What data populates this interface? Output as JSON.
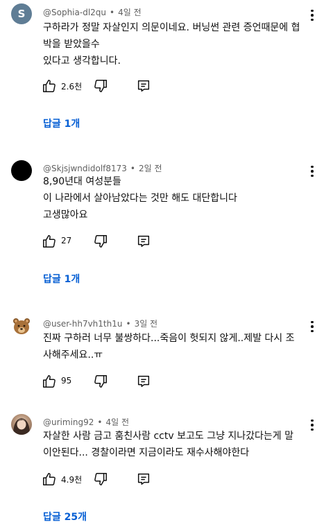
{
  "comments": [
    {
      "username": "@Sophia-dl2qu",
      "time": "4일 전",
      "avatar_letter": "S",
      "lines": [
        "구하라가 정말 자살인지 의문이네요. 버닝썬 관련 증언때문에 협",
        "박을 받았을수",
        "있다고 생각합니다."
      ],
      "likes": "2.6천",
      "replies": "답글 1개"
    },
    {
      "username": "@Skjsjwndidolf8173",
      "time": "2일 전",
      "lines": [
        "8,90년대 여성분들",
        "이 나라에서 살아남았다는 것만 해도 대단합니다",
        "고생많아요"
      ],
      "likes": "27",
      "replies": "답글 1개"
    },
    {
      "username": "@user-hh7vh1th1u",
      "time": "3일 전",
      "lines": [
        "진짜 구하러 너무 불쌍하다...죽음이 헛되지 않게..제발 다시 조",
        "사해주세요..ㅠ"
      ],
      "likes": "95"
    },
    {
      "username": "@uriming92",
      "time": "4일 전",
      "lines": [
        "자살한 사람 금고 훔친사람 cctv 보고도 그냥 지나갔다는게 말",
        "이안된다... 경찰이라면 지금이라도 재수사해야한다"
      ],
      "likes": "4.9천",
      "replies": "답글 25개"
    }
  ],
  "header_separator": "•",
  "colors": {
    "link": "#065fd4",
    "meta": "#606060",
    "text": "#0f0f0f"
  },
  "icons": [
    "thumbs-up-icon",
    "thumbs-down-icon",
    "reply-icon",
    "more-vert-icon"
  ]
}
